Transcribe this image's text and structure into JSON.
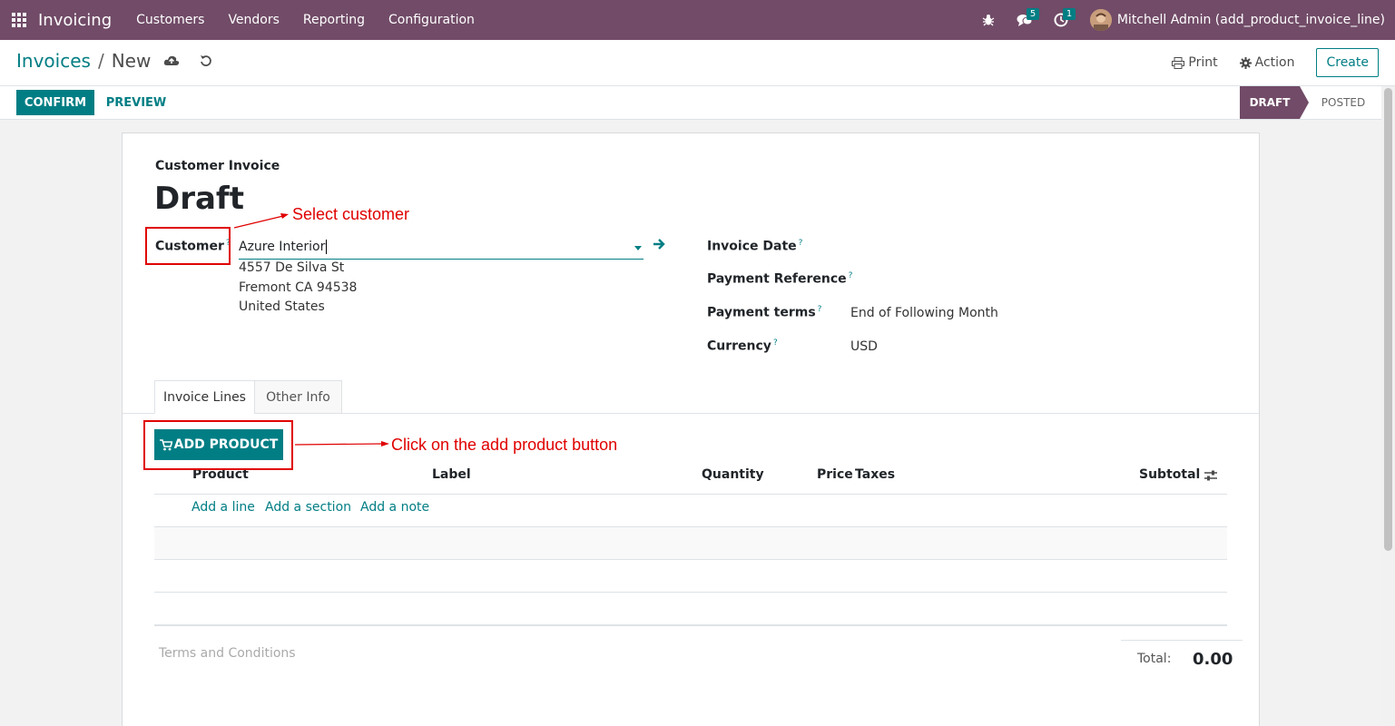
{
  "topnav": {
    "app_name": "Invoicing",
    "menu": [
      "Customers",
      "Vendors",
      "Reporting",
      "Configuration"
    ],
    "messages_count": "5",
    "activities_count": "1",
    "user": "Mitchell Admin (add_product_invoice_line)"
  },
  "control_panel": {
    "breadcrumb_parent": "Invoices",
    "breadcrumb_separator": "/",
    "breadcrumb_current": "New",
    "print_label": "Print",
    "action_label": "Action",
    "create_label": "Create"
  },
  "statusbar": {
    "confirm_label": "CONFIRM",
    "preview_label": "PREVIEW",
    "stages": [
      "DRAFT",
      "POSTED"
    ],
    "active_stage": "DRAFT"
  },
  "form": {
    "kind": "Customer Invoice",
    "state": "Draft",
    "customer_label": "Customer",
    "customer_value": "Azure Interior",
    "address": [
      "4557 De Silva St",
      "Fremont CA 94538",
      "United States"
    ],
    "invoice_date_label": "Invoice Date",
    "payment_reference_label": "Payment Reference",
    "payment_terms_label": "Payment terms",
    "payment_terms_value": "End of Following Month",
    "currency_label": "Currency",
    "currency_value": "USD",
    "help_mark": "?"
  },
  "tabs": [
    "Invoice Lines",
    "Other Info"
  ],
  "lines": {
    "add_product_label": "ADD PRODUCT",
    "columns": [
      "Product",
      "Label",
      "Quantity",
      "Price",
      "Taxes",
      "Subtotal"
    ],
    "add_line": "Add a line",
    "add_section": "Add a section",
    "add_note": "Add a note"
  },
  "footer": {
    "terms_placeholder": "Terms and Conditions",
    "total_label": "Total:",
    "total_value": "0.00"
  },
  "annotations": {
    "select_customer": "Select customer",
    "click_add_product": "Click on the add product button"
  },
  "colors": {
    "brand": "#714b67",
    "accent": "#017e84",
    "annotation": "#e00000"
  }
}
